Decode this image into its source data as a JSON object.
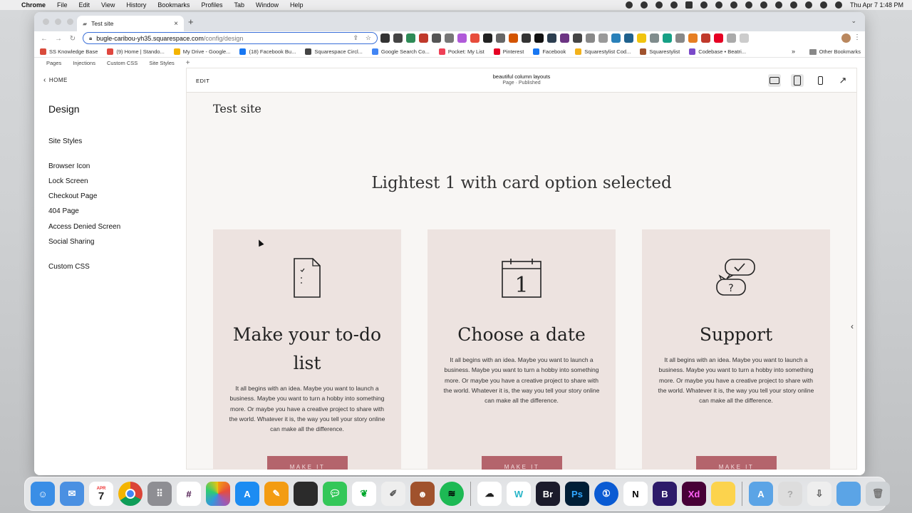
{
  "menubar": {
    "app": "Chrome",
    "items": [
      "File",
      "Edit",
      "View",
      "History",
      "Bookmarks",
      "Profiles",
      "Tab",
      "Window",
      "Help"
    ],
    "clock": "Thu Apr 7  1:48 PM"
  },
  "browser": {
    "tab_title": "Test site",
    "url_host": "bugle-caribou-yh35.squarespace.com",
    "url_path": "/config/design",
    "bookmarks": [
      {
        "label": "SS Knowledge Base",
        "color": "#d94b3b"
      },
      {
        "label": "(9) Home | Stando...",
        "color": "#e0473f"
      },
      {
        "label": "My Drive - Google...",
        "color": "#f4b400"
      },
      {
        "label": "(18) Facebook Bu...",
        "color": "#1877f2"
      },
      {
        "label": "Squarespace Circl...",
        "color": "#444444"
      },
      {
        "label": "Google Search Co...",
        "color": "#4285f4"
      },
      {
        "label": "Pocket: My List",
        "color": "#ef4056"
      },
      {
        "label": "Pinterest",
        "color": "#e60023"
      },
      {
        "label": "Facebook",
        "color": "#1877f2"
      },
      {
        "label": "Squarestylist Cod...",
        "color": "#f3b21b"
      },
      {
        "label": "Squarestylist",
        "color": "#a0522d"
      },
      {
        "label": "Codebase • Beatri...",
        "color": "#7a49c9"
      }
    ],
    "more": "»",
    "other_bookmarks": "Other Bookmarks"
  },
  "ssnav": [
    "Pages",
    "Injections",
    "Custom CSS",
    "Site Styles"
  ],
  "sidebar": {
    "back": "HOME",
    "title": "Design",
    "items": [
      {
        "label": "Site Styles",
        "top": 0
      },
      {
        "label": "Browser Icon"
      },
      {
        "label": "Lock Screen"
      },
      {
        "label": "Checkout Page"
      },
      {
        "label": "404 Page"
      },
      {
        "label": "Access Denied Screen"
      },
      {
        "label": "Social Sharing"
      },
      {
        "label": "Custom CSS"
      }
    ]
  },
  "preview": {
    "edit": "EDIT",
    "page_name": "beautiful column layouts",
    "page_status": "Page · Published",
    "site_title": "Test site",
    "headline": "Lightest 1 with card option selected",
    "cards": [
      {
        "title_line1": "Make your to-do",
        "title_line2": "list",
        "body": "It all begins with an idea. Maybe you want to launch a business. Maybe you want to turn a hobby into something more. Or maybe you have a creative project to share with the world. Whatever it is, the way you tell your story online can make all the difference.",
        "button": "MAKE IT",
        "icon": "document-icon"
      },
      {
        "title_line1": "Choose a date",
        "title_line2": "",
        "body": "It all begins with an idea. Maybe you want to launch a business. Maybe you want to turn a hobby into something more. Or maybe you have a creative project to share with the world. Whatever it is, the way you tell your story online can make all the difference.",
        "button": "MAKE IT",
        "icon": "calendar-icon"
      },
      {
        "title_line1": "Support",
        "title_line2": "",
        "body": "It all begins with an idea. Maybe you want to launch a business. Maybe you want to turn a hobby into something more. Or maybe you have a creative project to share with the world. Whatever it is, the way you tell your story online can make all the difference.",
        "button": "MAKE IT",
        "icon": "chat-bubbles-icon"
      }
    ],
    "calendar_number": "1",
    "button_color": "#b4646c",
    "card_color": "#ede3e0"
  },
  "dock": {
    "calendar_month": "APR",
    "calendar_day": "7"
  }
}
